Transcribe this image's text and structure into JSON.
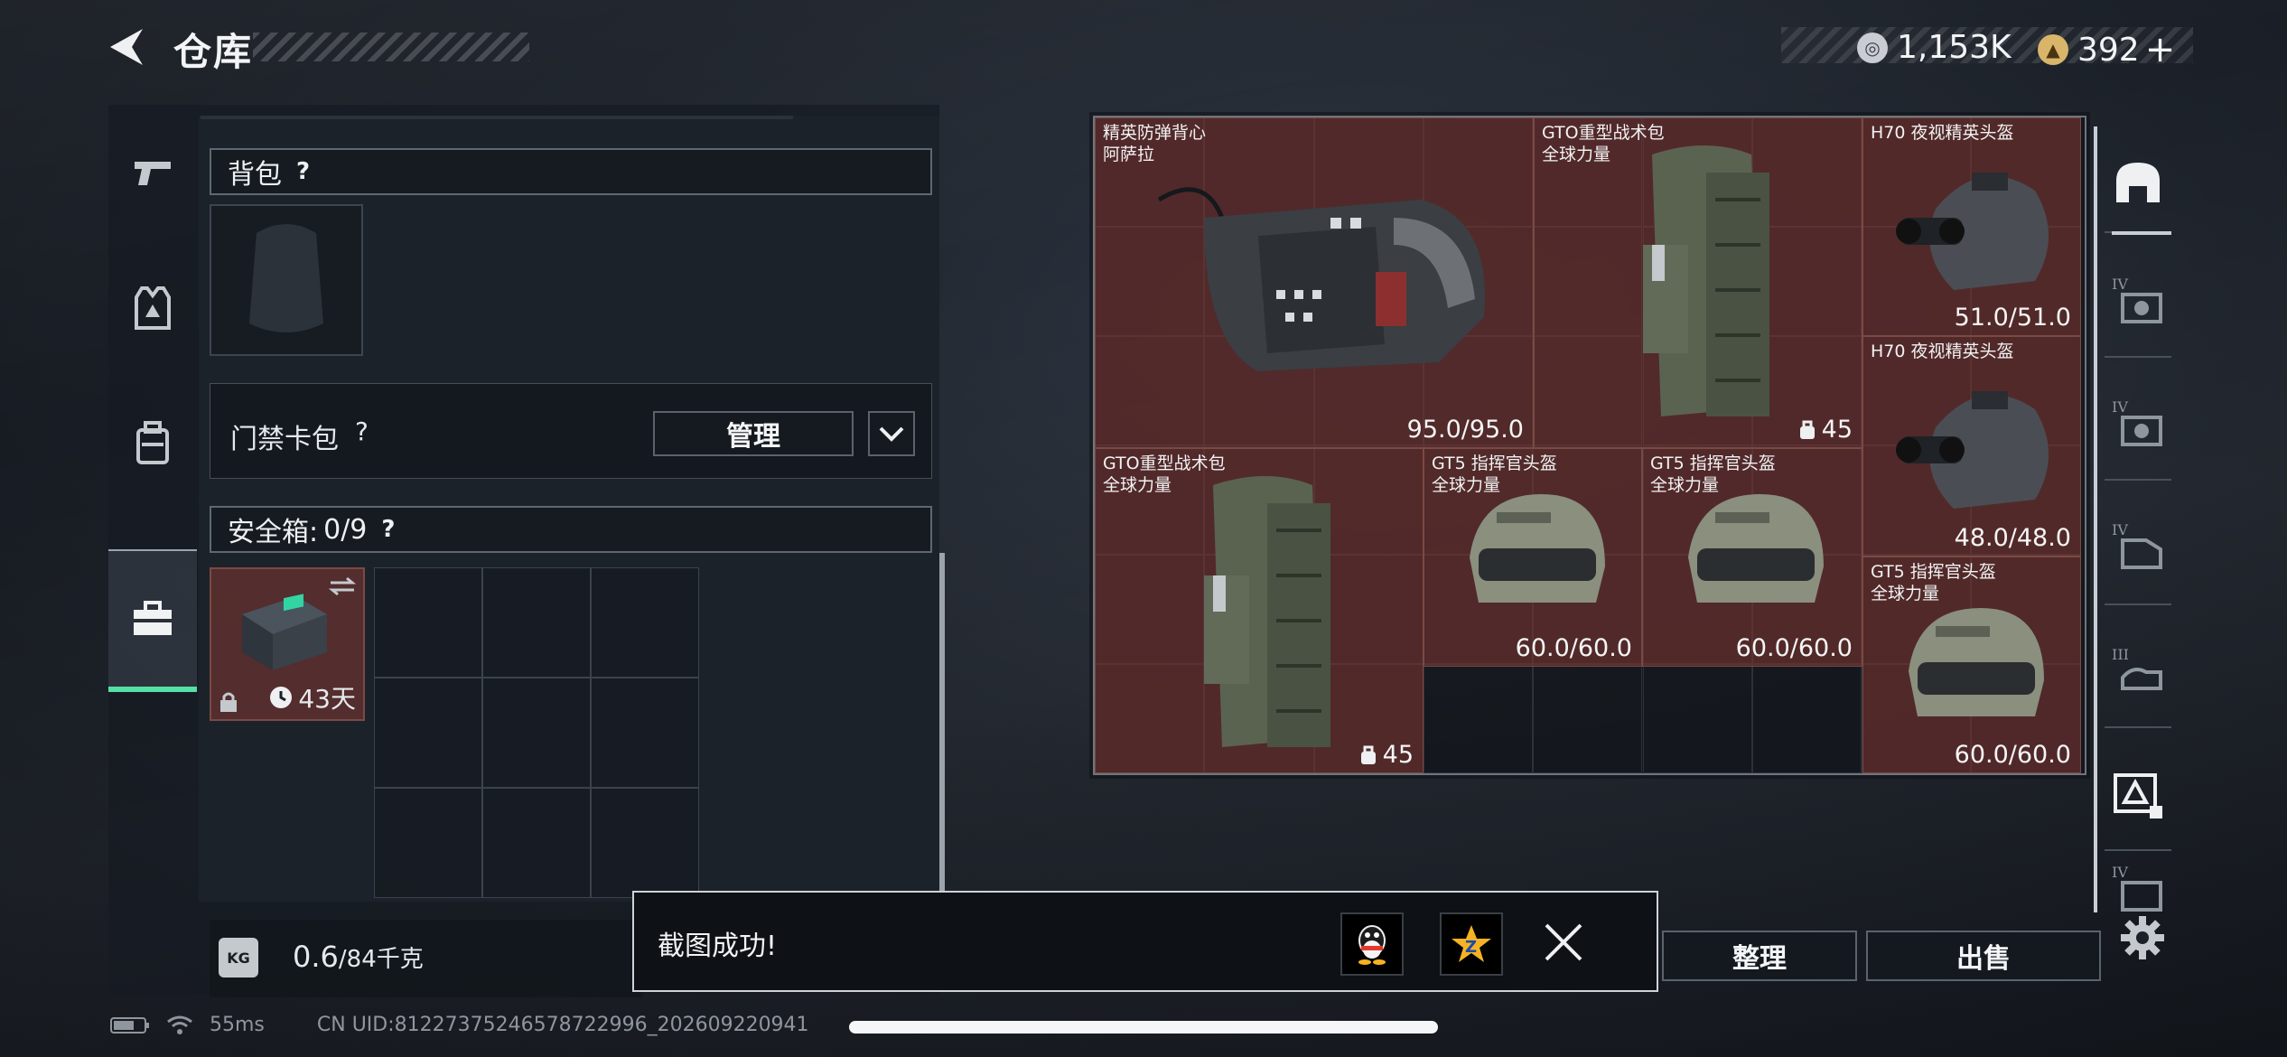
{
  "header": {
    "title": "仓库",
    "currency": [
      {
        "icon": "silver-coin-icon",
        "value": "1,153K"
      },
      {
        "icon": "gold-coin-icon",
        "value": "392"
      }
    ],
    "add_label": "+"
  },
  "left_tabs": [
    {
      "icon": "pistol-icon",
      "active": false
    },
    {
      "icon": "vest-icon",
      "active": false
    },
    {
      "icon": "backpack-icon",
      "active": false
    },
    {
      "icon": "toolbox-icon",
      "active": true
    }
  ],
  "backpack": {
    "label": "背包",
    "help": "?"
  },
  "keycard": {
    "label": "门禁卡包",
    "help": "?",
    "manage_label": "管理"
  },
  "safebox": {
    "label": "安全箱:",
    "count": "0/9",
    "help": "?",
    "days": "43天"
  },
  "weight": {
    "current": "0.6",
    "max": "/84千克"
  },
  "inventory": {
    "items": [
      {
        "name": "精英防弹背心\n阿萨拉",
        "value": "95.0/95.0"
      },
      {
        "name": "GTO重型战术包\n全球力量",
        "value": "45"
      },
      {
        "name": "H70 夜视精英头盔",
        "value": "51.0/51.0"
      },
      {
        "name": "H70 夜视精英头盔",
        "value": "48.0/48.0"
      },
      {
        "name": "GTO重型战术包\n全球力量",
        "value": "45"
      },
      {
        "name": "GT5 指挥官头盔\n全球力量",
        "value": "60.0/60.0"
      },
      {
        "name": "GT5 指挥官头盔\n全球力量",
        "value": "60.0/60.0"
      },
      {
        "name": "GT5 指挥官头盔\n全球力量",
        "value": "60.0/60.0"
      }
    ]
  },
  "right_rail": [
    {
      "icon": "helmet-category-icon",
      "tier": ""
    },
    {
      "icon": "weapon-crate-icon",
      "tier": "IV"
    },
    {
      "icon": "weapon-crate-icon",
      "tier": "IV"
    },
    {
      "icon": "document-crate-icon",
      "tier": "IV"
    },
    {
      "icon": "hand-crate-icon",
      "tier": "III"
    },
    {
      "icon": "gold-crate-icon",
      "tier": ""
    },
    {
      "icon": "crate-icon",
      "tier": "IV"
    }
  ],
  "actions": {
    "sort_label": "整理",
    "sell_label": "出售"
  },
  "toast": {
    "message": "截图成功!"
  },
  "status": {
    "latency": "55ms",
    "uid": "CN UID:81227375246578722996_202609220941"
  },
  "colors": {
    "accent_green": "#55e0a4",
    "item_red": "#7a3630"
  }
}
